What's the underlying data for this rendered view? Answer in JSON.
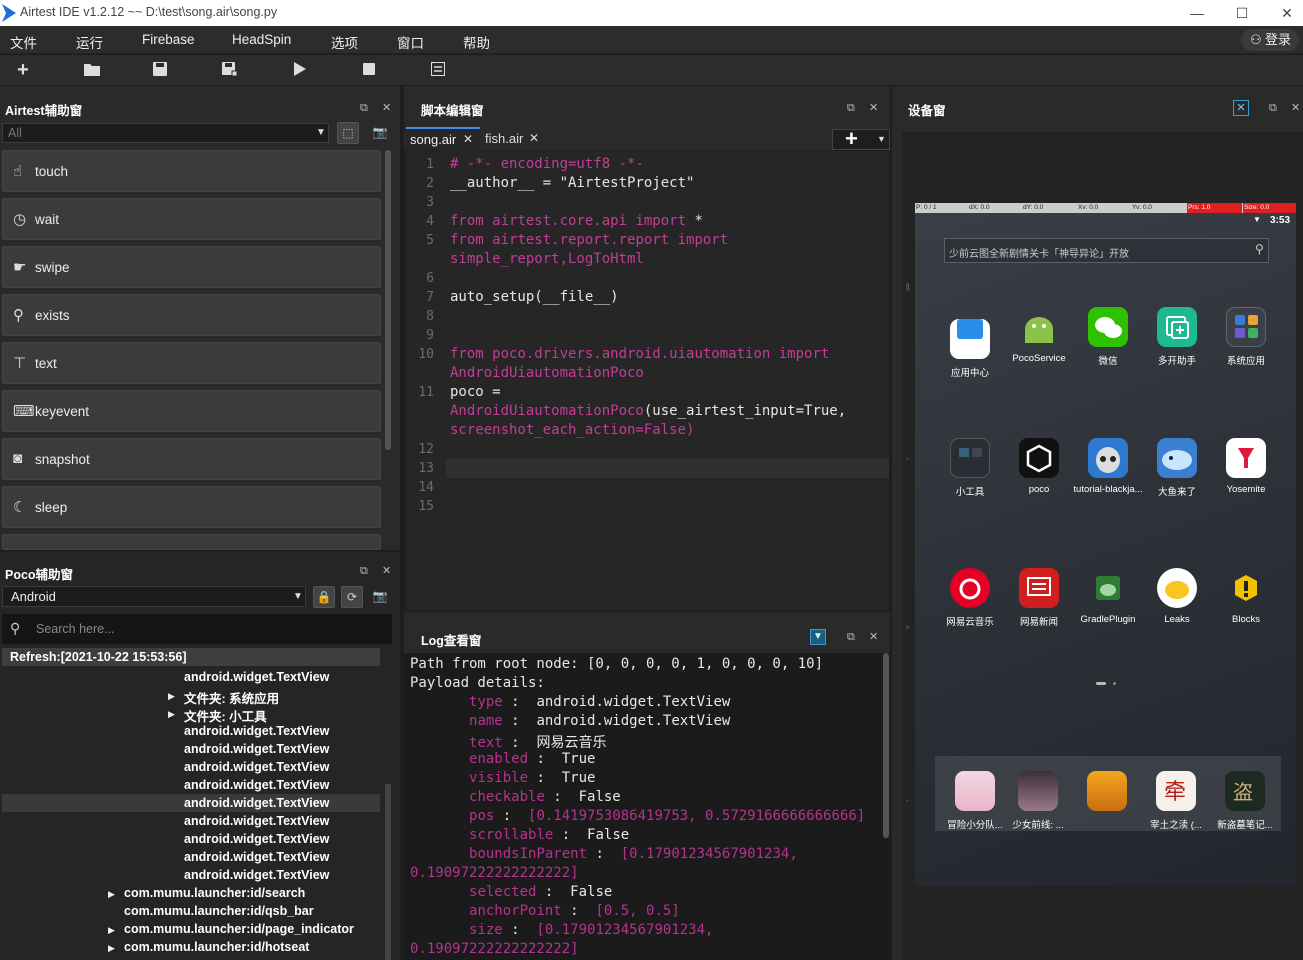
{
  "titlebar": {
    "title": "Airtest IDE v1.2.12 ~~ D:\\test\\song.air\\song.py",
    "minimize": "—",
    "maximize": "☐",
    "close": "✕"
  },
  "menu": [
    "文件",
    "运行",
    "Firebase",
    "HeadSpin",
    "选项",
    "窗口",
    "帮助"
  ],
  "login": "登录",
  "airtest_panel": {
    "title": "Airtest辅助窗",
    "filter": "All",
    "commands": [
      "touch",
      "wait",
      "swipe",
      "exists",
      "text",
      "keyevent",
      "snapshot",
      "sleep"
    ]
  },
  "poco_panel": {
    "title": "Poco辅助窗",
    "platform": "Android",
    "search_placeholder": "Search here...",
    "refresh": "Refresh:[2021-10-22 15:53:56]",
    "tree": [
      {
        "text": "android.widget.TextView",
        "arrow": ""
      },
      {
        "text": "文件夹: 系统应用",
        "arrow": "▶"
      },
      {
        "text": "文件夹: 小工具",
        "arrow": "▶"
      },
      {
        "text": "android.widget.TextView",
        "arrow": ""
      },
      {
        "text": "android.widget.TextView",
        "arrow": ""
      },
      {
        "text": "android.widget.TextView",
        "arrow": ""
      },
      {
        "text": "android.widget.TextView",
        "arrow": ""
      },
      {
        "text": "android.widget.TextView",
        "arrow": ""
      },
      {
        "text": "android.widget.TextView",
        "arrow": ""
      },
      {
        "text": "android.widget.TextView",
        "arrow": ""
      },
      {
        "text": "android.widget.TextView",
        "arrow": ""
      },
      {
        "text": "android.widget.TextView",
        "arrow": ""
      },
      {
        "text": "com.mumu.launcher:id/search",
        "arrow": "▶"
      },
      {
        "text": "com.mumu.launcher:id/qsb_bar",
        "arrow": ""
      },
      {
        "text": "com.mumu.launcher:id/page_indicator",
        "arrow": "▶"
      },
      {
        "text": "com.mumu.launcher:id/hotseat",
        "arrow": "▶"
      }
    ]
  },
  "editor_panel": {
    "title": "脚本编辑窗",
    "tabs": [
      "song.air",
      "fish.air"
    ],
    "tab_close": "✕",
    "add": "+"
  },
  "code": {
    "line_numbers": [
      "1",
      "2",
      "3",
      "4",
      "5",
      "",
      "6",
      "7",
      "8",
      "9",
      "10",
      "",
      "11",
      "",
      "",
      "12",
      "13",
      "14",
      "15"
    ]
  },
  "log_panel": {
    "title": "Log查看窗",
    "lines": [
      {
        "k": "",
        "v": "Path from root node: [0, 0, 0, 0, 1, 0, 0, 0, 10]"
      },
      {
        "k": "",
        "v": "Payload details:"
      },
      {
        "k": "type",
        "v": "android.widget.TextView"
      },
      {
        "k": "name",
        "v": "android.widget.TextView"
      },
      {
        "k": "text",
        "v": "网易云音乐"
      },
      {
        "k": "enabled",
        "v": "True"
      },
      {
        "k": "visible",
        "v": "True"
      },
      {
        "k": "checkable",
        "v": "False"
      },
      {
        "k": "pos",
        "v": "[0.1419753086419753, 0.5729166666666666]"
      },
      {
        "k": "scrollable",
        "v": "False"
      },
      {
        "k": "boundsInParent",
        "v": "[0.17901234567901234,"
      },
      {
        "k": "",
        "v": "0.19097222222222222]"
      },
      {
        "k": "selected",
        "v": "False"
      },
      {
        "k": "anchorPoint",
        "v": "[0.5, 0.5]"
      },
      {
        "k": "size",
        "v": "[0.17901234567901234,"
      },
      {
        "k": "",
        "v": "0.19097222222222222]"
      }
    ]
  },
  "device_panel": {
    "title": "设备窗",
    "status": [
      "P: 0 / 1",
      "dX: 0.0",
      "dY: 0.0",
      "Xv: 0.0",
      "Yv: 0.0",
      "Prs: 1.0",
      "Size: 0.0"
    ],
    "time": "3:53",
    "search_text": "少前云图全新剧情关卡「神导异论」开放",
    "apps_row1": [
      "应用中心",
      "PocoService",
      "微信",
      "多开助手",
      "系统应用"
    ],
    "apps_row2": [
      "小工具",
      "poco",
      "tutorial-blackja...",
      "大鱼来了",
      "Yosemite"
    ],
    "apps_row3": [
      "网易云音乐",
      "网易新闻",
      "GradlePlugin",
      "Leaks",
      "Blocks"
    ],
    "dock": [
      "冒险小分队...",
      "少女前线: ...",
      "",
      "宰土之渎 (...",
      "新盗墓笔记..."
    ]
  },
  "colors": {
    "accent": "#c23d98",
    "panel_bg": "#2c2c2c",
    "editor_bg": "#262626"
  }
}
